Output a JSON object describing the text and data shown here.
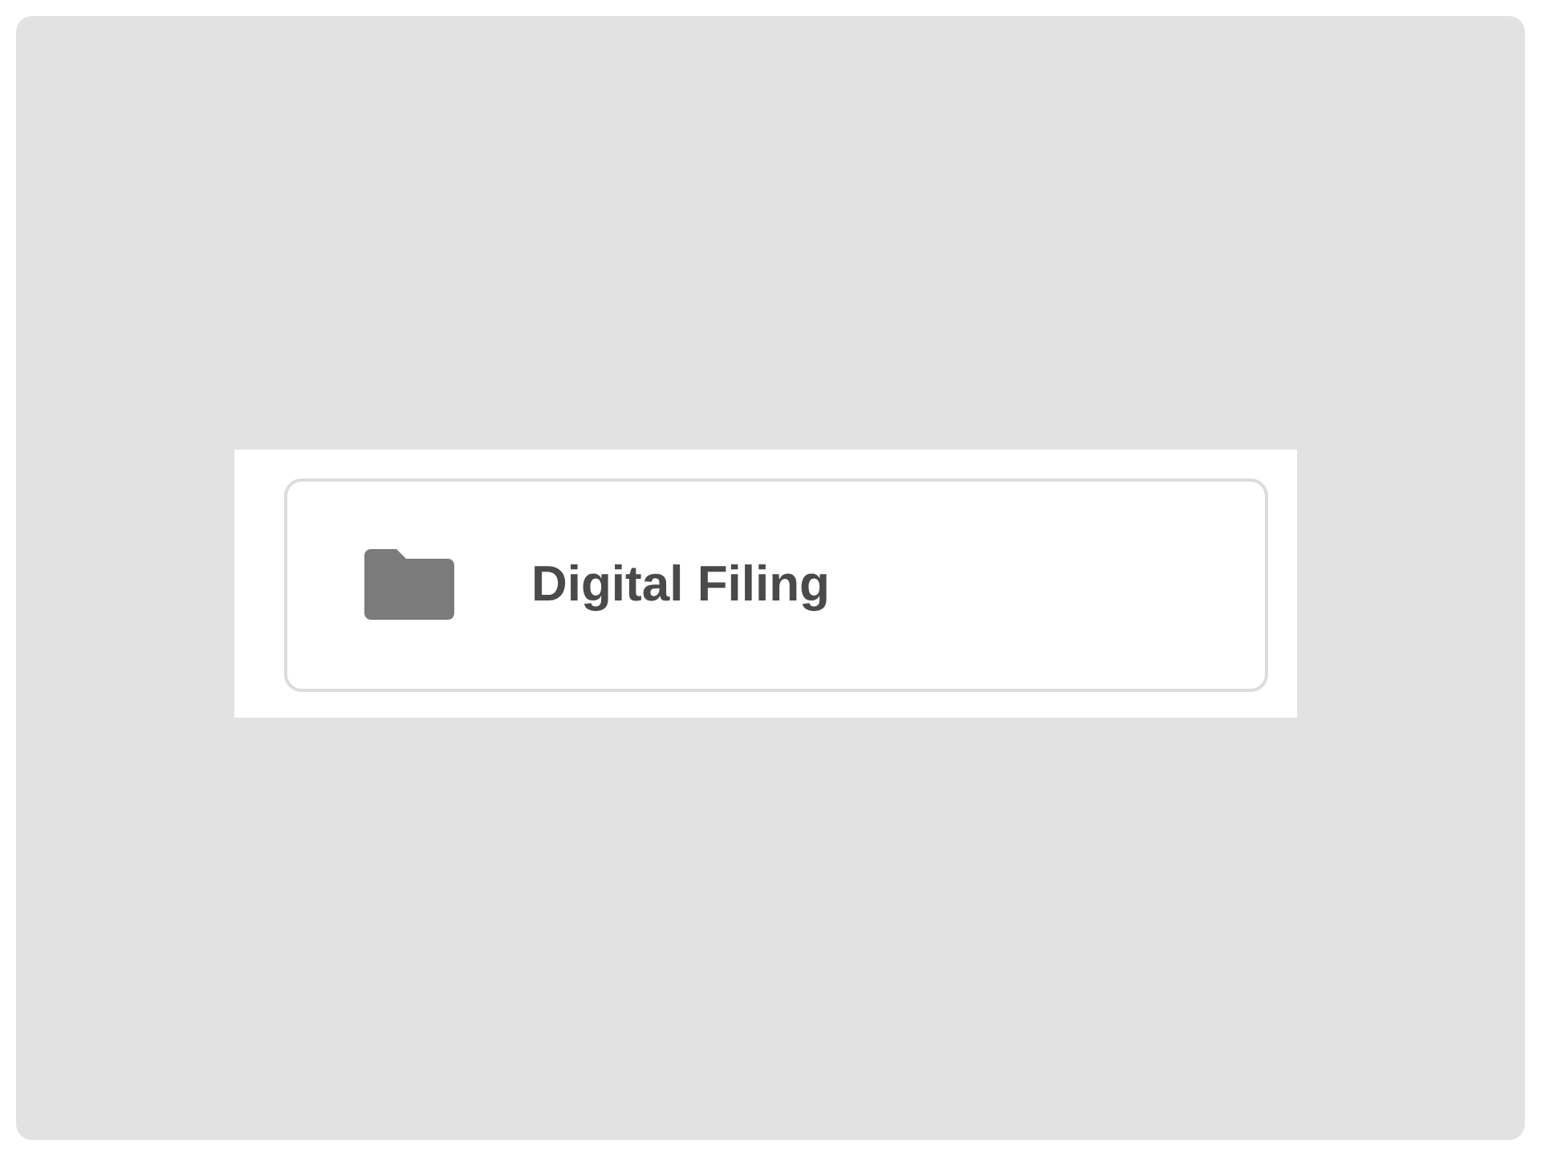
{
  "folder": {
    "name": "Digital Filing"
  }
}
